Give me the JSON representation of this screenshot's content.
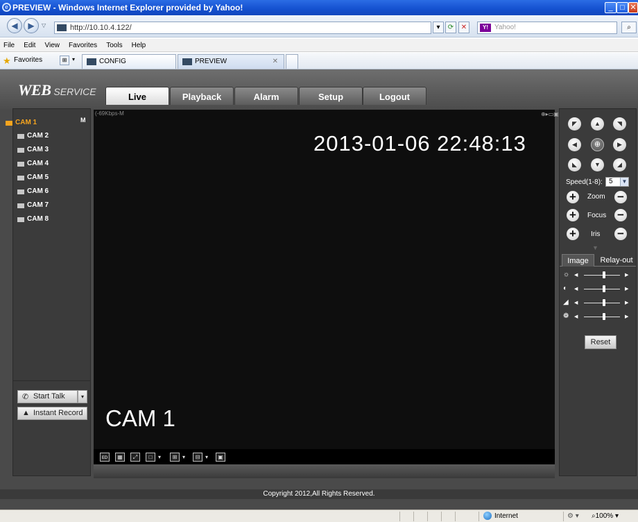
{
  "browser": {
    "title": "PREVIEW - Windows Internet Explorer provided by Yahoo!",
    "address": "http://10.10.4.122/",
    "search_placeholder": "Yahoo!",
    "menu": [
      "File",
      "Edit",
      "View",
      "Favorites",
      "Tools",
      "Help"
    ],
    "favorites_label": "Favorites",
    "tabs": [
      {
        "label": "CONFIG"
      },
      {
        "label": "PREVIEW"
      }
    ]
  },
  "app": {
    "logo_main": "WEB",
    "logo_sub": "SERVICE",
    "nav": [
      "Live",
      "Playback",
      "Alarm",
      "Setup",
      "Logout"
    ],
    "active_nav": "Live"
  },
  "cameras": {
    "items": [
      "CAM 1",
      "CAM 2",
      "CAM 3",
      "CAM 4",
      "CAM 5",
      "CAM 6",
      "CAM 7",
      "CAM 8"
    ],
    "active": "CAM 1",
    "active_badge": "M"
  },
  "actions": {
    "start_talk": "Start Talk",
    "instant_record": "Instant Record"
  },
  "video": {
    "bitrate": "(-69Kbps-M",
    "timestamp": "2013-01-06 22:48:13",
    "camera_label": "CAM 1"
  },
  "ptz": {
    "speed_label": "Speed(1-8):",
    "speed_value": "5",
    "zoom_label": "Zoom",
    "focus_label": "Focus",
    "iris_label": "Iris"
  },
  "image_panel": {
    "tabs": [
      "Image",
      "Relay-out"
    ],
    "reset_label": "Reset",
    "sliders": [
      {
        "icon": "brightness-icon",
        "level": 0.55
      },
      {
        "icon": "contrast-icon",
        "level": 0.55
      },
      {
        "icon": "saturation-icon",
        "level": 0.55
      },
      {
        "icon": "hue-icon",
        "level": 0.55
      }
    ]
  },
  "footer": {
    "copyright": "Copyright 2012,All Rights Reserved."
  },
  "status": {
    "zone": "Internet",
    "zoom": "100%"
  }
}
